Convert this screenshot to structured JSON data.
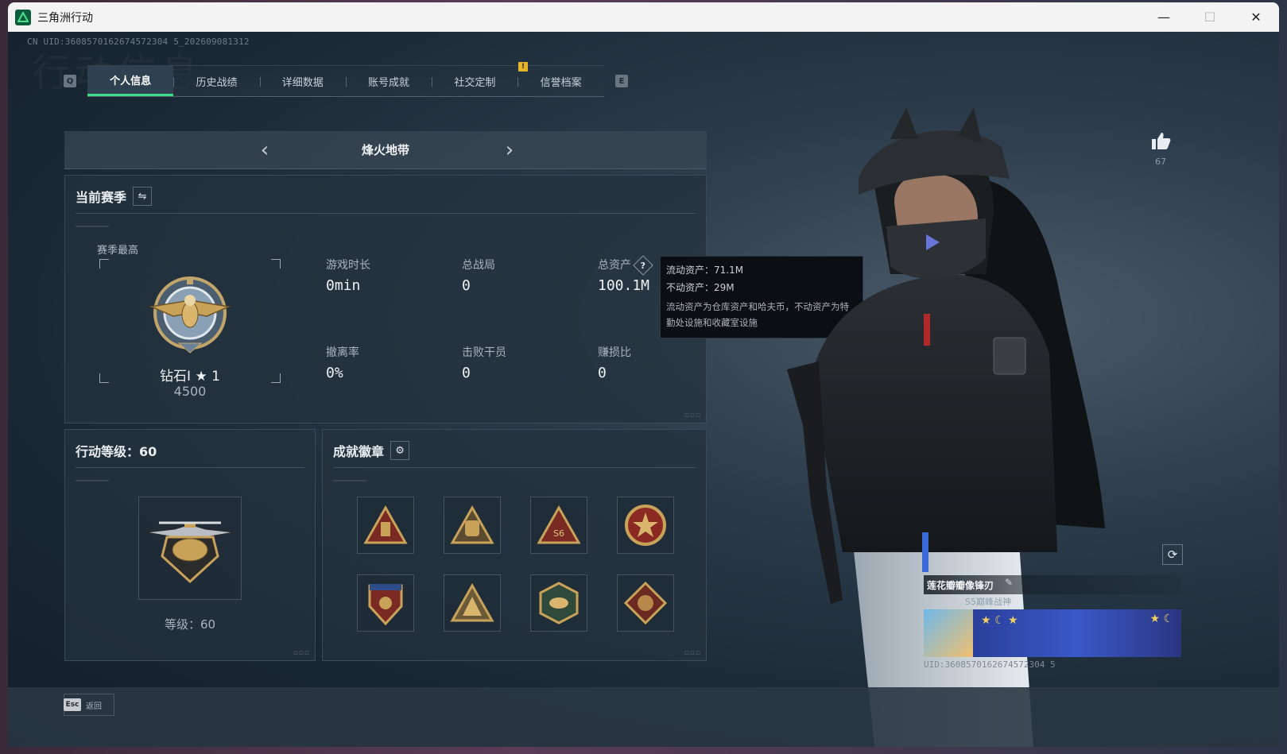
{
  "window": {
    "title": "三角洲行动",
    "minimize_glyph": "—",
    "maximize_glyph": "☐",
    "close_glyph": "✕"
  },
  "uid_text": "CN UID:3608570162674572304 5_202609081312",
  "watermark": "行动信息",
  "tabs": {
    "left_key": "Q",
    "right_key": "E",
    "badge": "!",
    "items": [
      {
        "label": "个人信息",
        "active": true
      },
      {
        "label": "历史战绩"
      },
      {
        "label": "详细数据"
      },
      {
        "label": "账号成就"
      },
      {
        "label": "社交定制"
      },
      {
        "label": "信誉档案"
      }
    ]
  },
  "mode": {
    "title": "烽火地带",
    "prev_glyph": "‹",
    "next_glyph": "›"
  },
  "season": {
    "title": "当前赛季",
    "switch_glyph": "⇋",
    "best_label": "赛季最高",
    "rank_name": "钻石Ⅰ ★ 1",
    "rank_points": "4500",
    "stats": [
      {
        "label": "游戏时长",
        "value": "0min"
      },
      {
        "label": "总战局",
        "value": "0"
      },
      {
        "label": "总资产",
        "value": "100.1M"
      },
      {
        "label": "撤离率",
        "value": "0%"
      },
      {
        "label": "击败干员",
        "value": "0"
      },
      {
        "label": "赚损比",
        "value": "0"
      }
    ],
    "help_glyph": "?"
  },
  "tooltip": {
    "liquid": "流动资产：71.1M",
    "fixed": "不动资产：29M",
    "note": "流动资产为仓库资产和哈夫币，不动资产为特勤处设施和收藏室设施"
  },
  "level": {
    "title": "行动等级：60",
    "text": "等级：60"
  },
  "badges": {
    "title": "成就徽章",
    "settings_glyph": "⚙",
    "items": [
      "badge-1",
      "badge-2",
      "badge-3",
      "badge-4",
      "badge-5",
      "badge-6",
      "badge-7",
      "badge-8"
    ]
  },
  "likes": {
    "count": "67"
  },
  "card": {
    "name": "莲花瓣瓣像锋刃",
    "subtitle": "S5巅峰战神",
    "uid": "UID:3608570162674572304 5"
  },
  "footer": {
    "esc_key": "Esc",
    "esc_label": "返回"
  },
  "colors": {
    "accent": "#3fdc8a",
    "badge_gold": "#e5b62a",
    "panel": "#24323e"
  }
}
